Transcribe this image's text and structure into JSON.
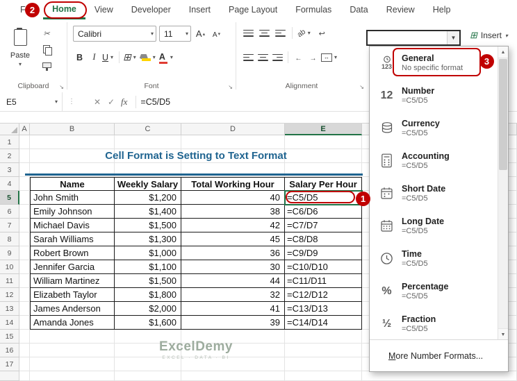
{
  "ribbon": {
    "tabs": [
      {
        "label": "File"
      },
      {
        "label": "Home",
        "active": true
      },
      {
        "label": "View"
      },
      {
        "label": "Developer"
      },
      {
        "label": "Insert"
      },
      {
        "label": "Page Layout"
      },
      {
        "label": "Formulas"
      },
      {
        "label": "Data"
      },
      {
        "label": "Review"
      },
      {
        "label": "Help"
      }
    ],
    "clipboard_group": {
      "label": "Clipboard",
      "paste_label": "Paste"
    },
    "font_group": {
      "label": "Font",
      "font_name": "Calibri",
      "font_size": "11",
      "bold": "B",
      "italic": "I",
      "underline": "U"
    },
    "alignment_group": {
      "label": "Alignment"
    },
    "number_format_box": {
      "value": ""
    },
    "insert_button_label": "Insert"
  },
  "formula_bar": {
    "name_box": "E5",
    "fx_label": "fx",
    "formula": "=C5/D5"
  },
  "grid": {
    "columns": [
      "A",
      "B",
      "C",
      "D",
      "E"
    ],
    "row_numbers": [
      "1",
      "2",
      "3",
      "4",
      "5",
      "6",
      "7",
      "8",
      "9",
      "10",
      "11",
      "12",
      "13",
      "14",
      "15",
      "16",
      "17"
    ],
    "selection": {
      "active_cell": "E5"
    },
    "title": "Cell Format is Setting to Text Format",
    "table": {
      "headers": [
        "Name",
        "Weekly Salary",
        "Total Working Hour",
        "Salary Per Hour"
      ],
      "rows": [
        [
          "John Smith",
          "$1,200",
          "40",
          "=C5/D5"
        ],
        [
          "Emily Johnson",
          "$1,400",
          "38",
          "=C6/D6"
        ],
        [
          "Michael Davis",
          "$1,500",
          "42",
          "=C7/D7"
        ],
        [
          "Sarah Williams",
          "$1,300",
          "45",
          "=C8/D8"
        ],
        [
          "Robert Brown",
          "$1,000",
          "36",
          "=C9/D9"
        ],
        [
          "Jennifer Garcia",
          "$1,100",
          "30",
          "=C10/D10"
        ],
        [
          "William Martinez",
          "$1,500",
          "44",
          "=C11/D11"
        ],
        [
          "Elizabeth Taylor",
          "$1,800",
          "32",
          "=C12/D12"
        ],
        [
          "James Anderson",
          "$2,000",
          "41",
          "=C13/D13"
        ],
        [
          "Amanda Jones",
          "$1,600",
          "39",
          "=C14/D14"
        ]
      ]
    },
    "watermark": {
      "name": "ExcelDemy",
      "tagline": "EXCEL · DATA · BI"
    }
  },
  "format_menu": {
    "items": [
      {
        "label": "General",
        "preview": "No specific format",
        "icon_text": "123"
      },
      {
        "label": "Number",
        "preview": "=C5/D5",
        "icon_text": "12"
      },
      {
        "label": "Currency",
        "preview": "=C5/D5",
        "icon_text": ""
      },
      {
        "label": "Accounting",
        "preview": "=C5/D5",
        "icon_text": ""
      },
      {
        "label": "Short Date",
        "preview": "=C5/D5",
        "icon_text": ""
      },
      {
        "label": "Long Date",
        "preview": "=C5/D5",
        "icon_text": ""
      },
      {
        "label": "Time",
        "preview": "=C5/D5",
        "icon_text": ""
      },
      {
        "label": "Percentage",
        "preview": "=C5/D5",
        "icon_text": "%"
      },
      {
        "label": "Fraction",
        "preview": "=C5/D5",
        "icon_text": "½"
      }
    ],
    "footer": "More Number Formats..."
  },
  "annotations": {
    "step_1": "1",
    "step_2": "2",
    "step_3": "3"
  },
  "colors": {
    "excel_green": "#217346",
    "annotation_red": "#C00000",
    "title_color": "#1F6490",
    "watermark_color": "#9DAC9E"
  }
}
